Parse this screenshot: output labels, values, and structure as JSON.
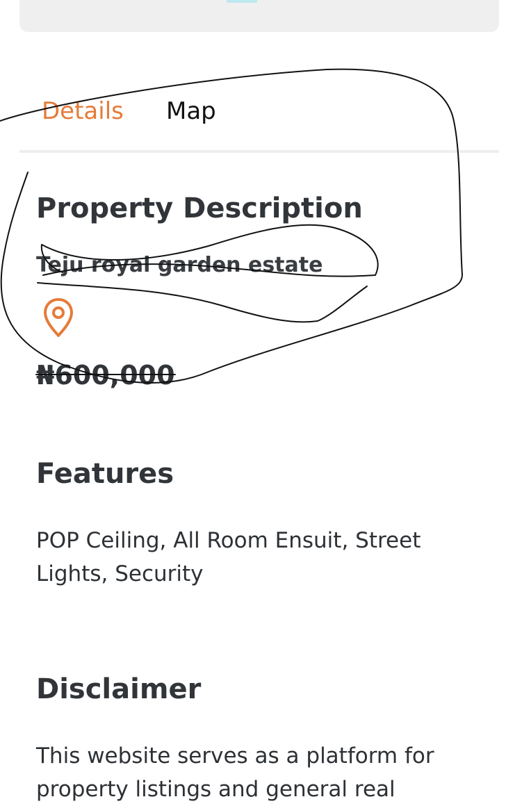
{
  "tabs": {
    "details_label": "Details",
    "map_label": "Map",
    "active_tab": "Details"
  },
  "property": {
    "description_title": "Property Description",
    "estate_name": "Teju royal garden estate",
    "price": "₦600,000",
    "location_icon": "map-pin-icon"
  },
  "features": {
    "title": "Features",
    "text": "POP Ceiling, All Room Ensuit, Street Lights, Security"
  },
  "disclaimer": {
    "title": "Disclaimer",
    "text": "This website serves as a platform for property listings and general real"
  },
  "colors": {
    "accent": "#e57b39",
    "text": "#313539",
    "divider": "#eeeeee",
    "card": "#efefef"
  }
}
